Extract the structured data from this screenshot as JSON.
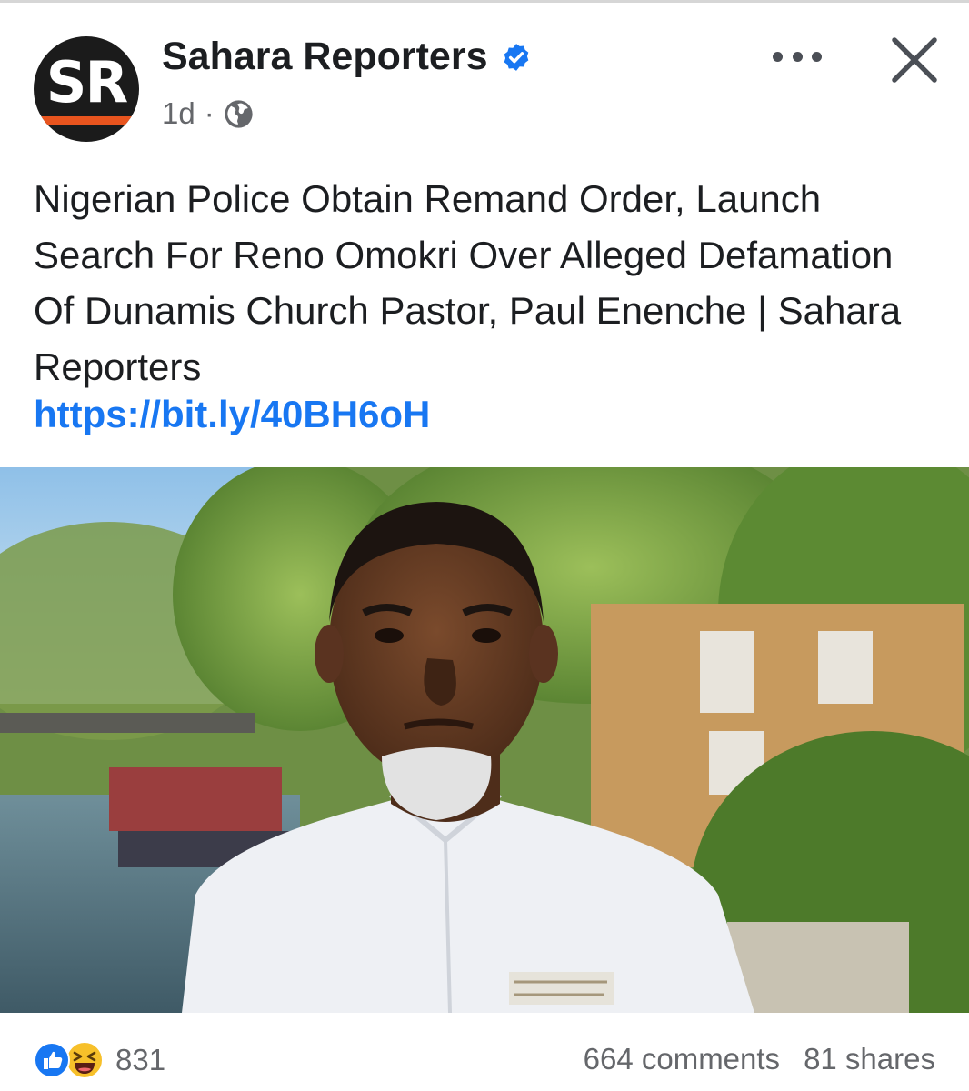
{
  "post": {
    "page_name": "Sahara Reporters",
    "logo_text": "SR",
    "time": "1d",
    "separator": "·",
    "body": "Nigerian Police Obtain Remand Order, Launch Search For Reno Omokri Over Alleged Defamation Of Dunamis Church Pastor, Paul Enenche | Sahara Reporters",
    "link": "https://bit.ly/40BH6oH"
  },
  "icons": {
    "verified": "verified-badge-icon",
    "audience": "globe-icon",
    "more": "more-options-icon",
    "close": "close-icon",
    "like": "like-reaction-icon",
    "haha": "haha-reaction-icon"
  },
  "footer": {
    "reaction_count": "831",
    "comments": "664 comments",
    "shares": "81 shares"
  },
  "colors": {
    "brand_blue": "#1877f2",
    "logo_bar": "#e8541e",
    "text_secondary": "#65676b"
  }
}
